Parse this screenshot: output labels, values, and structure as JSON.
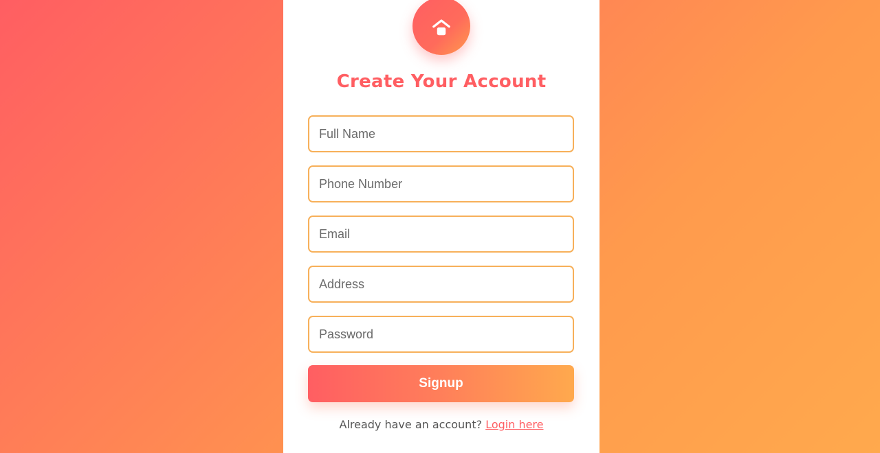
{
  "header": {
    "logo_icon": "home-icon",
    "title": "Create Your Account"
  },
  "form": {
    "fields": [
      {
        "name": "full-name",
        "placeholder": "Full Name",
        "value": ""
      },
      {
        "name": "phone-number",
        "placeholder": "Phone Number",
        "value": ""
      },
      {
        "name": "email",
        "placeholder": "Email",
        "value": ""
      },
      {
        "name": "address",
        "placeholder": "Address",
        "value": ""
      },
      {
        "name": "password",
        "placeholder": "Password",
        "value": ""
      }
    ],
    "submit_label": "Signup"
  },
  "footer": {
    "prompt": "Already have an account?",
    "link_label": "Login here"
  },
  "colors": {
    "accent": "#ff5e62",
    "accent_end": "#ffa94d",
    "field_border": "#f7b05a"
  }
}
